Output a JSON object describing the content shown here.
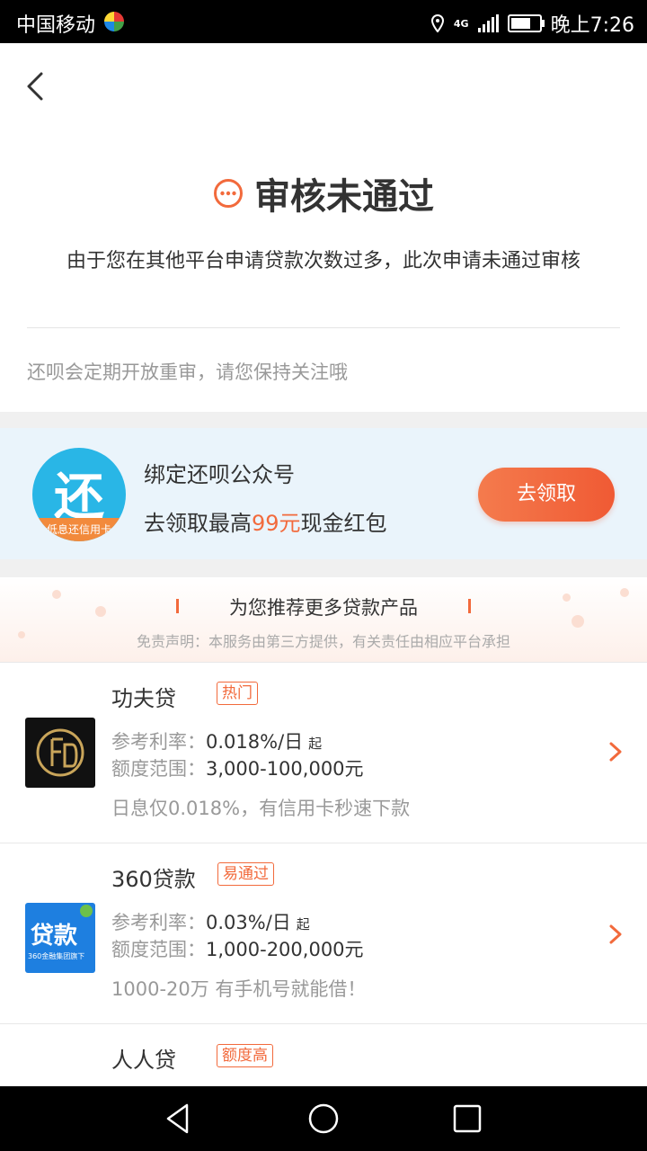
{
  "status_bar": {
    "carrier": "中国移动",
    "network": "4G",
    "time": "晚上7:26",
    "battery_level": 0.8
  },
  "header": {
    "title": "审核未通过",
    "subtitle": "由于您在其他平台申请贷款次数过多，此次申请未通过审核",
    "notice": "还呗会定期开放重审，请您保持关注哦"
  },
  "promo": {
    "logo_char": "还",
    "logo_ribbon": "低息还信用卡",
    "title": "绑定还呗公众号",
    "sub_prefix": "去领取最高",
    "sub_highlight": "99元",
    "sub_suffix": "现金红包",
    "button_label": "去领取"
  },
  "recommend": {
    "title": "为您推荐更多贷款产品",
    "disclaimer": "免责声明：本服务由第三方提供，有关责任由相应平台承担"
  },
  "loans": [
    {
      "name": "功夫贷",
      "tag": "热门",
      "rate_label": "参考利率：",
      "rate": "0.018%/日",
      "rate_unit": "起",
      "range_label": "额度范围：",
      "range": "3,000-100,000元",
      "desc": "日息仅0.018%，有信用卡秒速下款"
    },
    {
      "name": "360贷款",
      "tag": "易通过",
      "rate_label": "参考利率：",
      "rate": "0.03%/日",
      "rate_unit": "起",
      "range_label": "额度范围：",
      "range": "1,000-200,000元",
      "desc": "1000-20万 有手机号就能借！",
      "logo_text": "贷款",
      "logo_sub": "360金融集团旗下"
    },
    {
      "name": "人人贷",
      "tag": "额度高"
    }
  ],
  "colors": {
    "accent": "#f26a3c",
    "promo_bg": "#eaf4fb",
    "logo_blue": "#29b6e6"
  }
}
